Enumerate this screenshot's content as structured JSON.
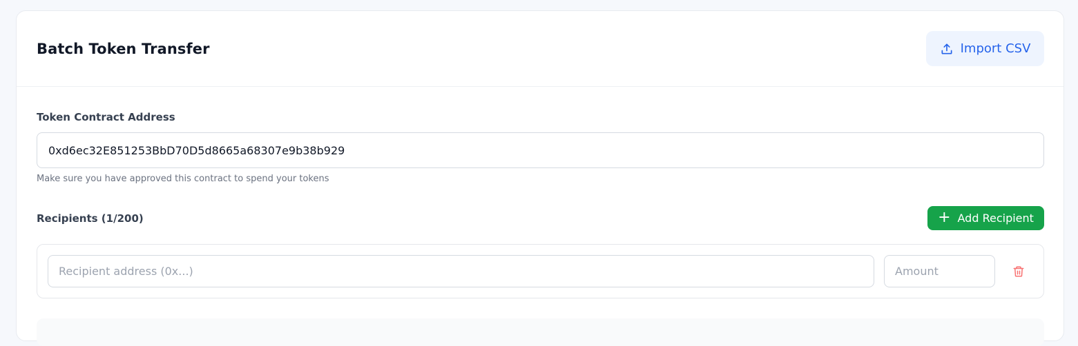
{
  "header": {
    "title": "Batch Token Transfer",
    "import_label": "Import CSV",
    "import_icon": "upload-icon"
  },
  "token": {
    "label": "Token Contract Address",
    "value": "0xd6ec32E851253BbD70D5d8665a68307e9b38b929",
    "hint": "Make sure you have approved this contract to spend your tokens"
  },
  "recipients": {
    "label": "Recipients (1/200)",
    "add_label": "Add Recipient",
    "add_icon": "plus-icon",
    "rows": [
      {
        "address_placeholder": "Recipient address (0x...)",
        "amount_placeholder": "Amount",
        "remove_icon": "trash-icon"
      }
    ]
  },
  "colors": {
    "accent_blue": "#2563eb",
    "import_bg": "#eef4fe",
    "add_green": "#16a34a",
    "trash_red": "#f87171"
  }
}
